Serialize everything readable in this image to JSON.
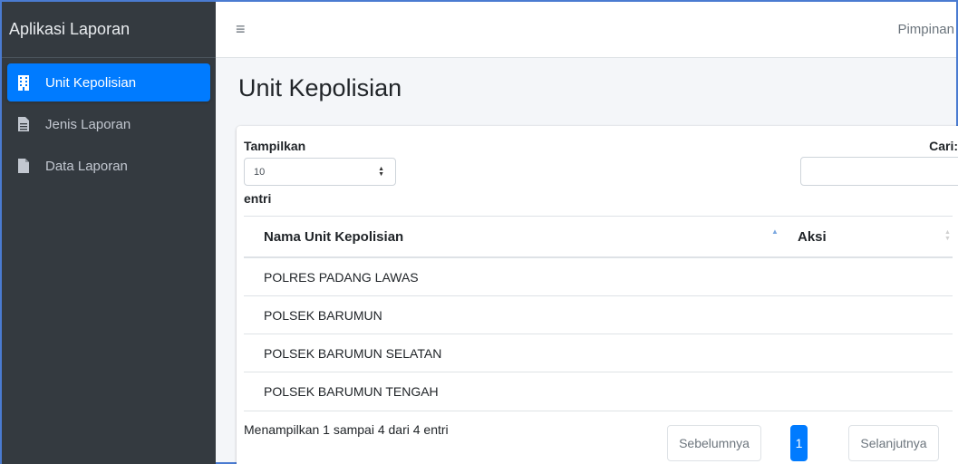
{
  "app": {
    "title": "Aplikasi Laporan"
  },
  "sidebar": {
    "items": [
      {
        "label": "Unit Kepolisian",
        "icon": "building-icon",
        "active": true
      },
      {
        "label": "Jenis Laporan",
        "icon": "file-lines-icon",
        "active": false
      },
      {
        "label": "Data Laporan",
        "icon": "file-icon",
        "active": false
      }
    ]
  },
  "topbar": {
    "menu_icon": "hamburger-icon",
    "user": "Pimpinan"
  },
  "page": {
    "title": "Unit Kepolisian"
  },
  "table_controls": {
    "show_label": "Tampilkan",
    "page_size": "10",
    "entries_label": "entri",
    "search_label": "Cari:",
    "search_value": ""
  },
  "table": {
    "columns": [
      "Nama Unit Kepolisian",
      "Aksi"
    ],
    "rows": [
      [
        "POLRES PADANG LAWAS",
        ""
      ],
      [
        "POLSEK BARUMUN",
        ""
      ],
      [
        "POLSEK BARUMUN SELATAN",
        ""
      ],
      [
        "POLSEK BARUMUN TENGAH",
        ""
      ]
    ]
  },
  "pagination": {
    "info": "Menampilkan 1 sampai 4 dari 4 entri",
    "prev": "Sebelumnya",
    "current": "1",
    "next": "Selanjutnya"
  },
  "colors": {
    "sidebar": "#343a40",
    "accent": "#007bff",
    "background": "#f4f6f9"
  }
}
